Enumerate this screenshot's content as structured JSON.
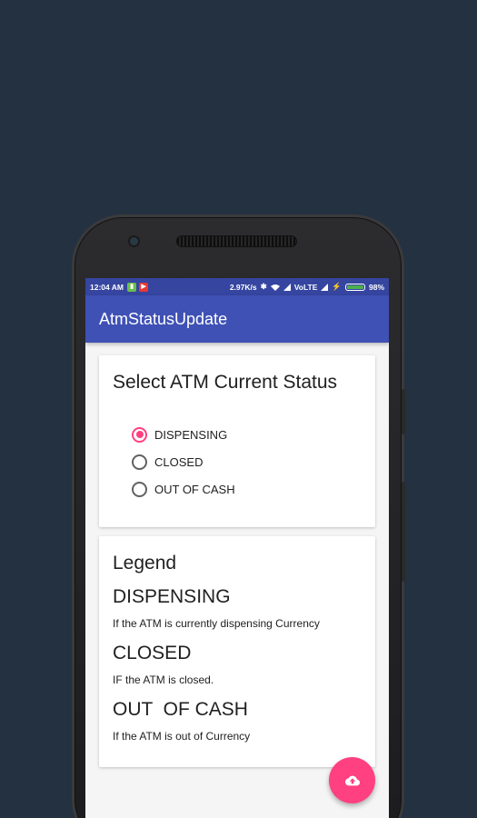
{
  "statusbar": {
    "time": "12:04 AM",
    "speed": "2.97K/s",
    "network": "VoLTE",
    "battery_percent": "98%",
    "battery_level": 0.98,
    "icons": [
      "battery-saver-icon",
      "youtube-icon",
      "bluetooth-icon",
      "wifi-icon",
      "signal-icon",
      "charging-icon"
    ]
  },
  "appbar": {
    "title": "AtmStatusUpdate"
  },
  "status_card": {
    "title": "Select ATM Current Status",
    "options": [
      {
        "label": "DISPENSING",
        "checked": true
      },
      {
        "label": "CLOSED",
        "checked": false
      },
      {
        "label": "OUT OF CASH",
        "checked": false
      }
    ]
  },
  "legend_card": {
    "title": "Legend",
    "items": [
      {
        "heading": "DISPENSING",
        "description": "If the ATM is currently dispensing Currency"
      },
      {
        "heading": "CLOSED",
        "description": "IF the ATM is closed."
      },
      {
        "heading": "OUT  OF CASH",
        "description": "If the ATM is out of Currency"
      }
    ]
  },
  "fab": {
    "icon": "cloud-upload-icon"
  },
  "colors": {
    "background": "#233140",
    "primary": "#3f51b5",
    "primary_dark": "#3545a0",
    "accent": "#ff4081"
  }
}
